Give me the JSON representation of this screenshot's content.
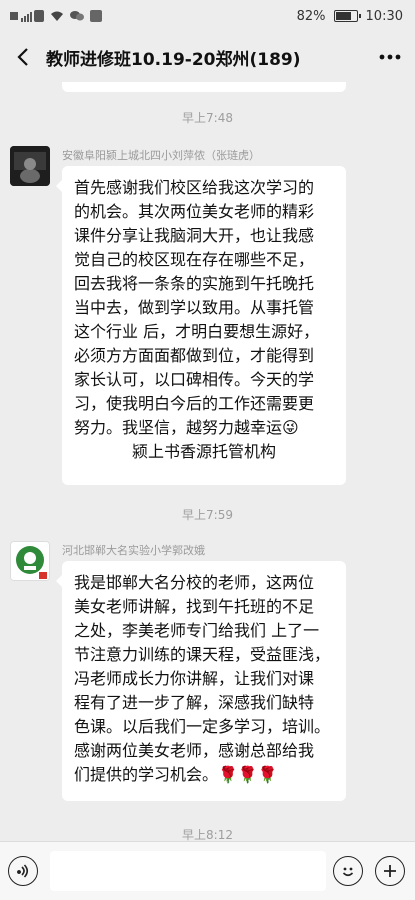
{
  "status": {
    "battery_text": "82%",
    "battery_level": 0.82,
    "time": "10:30"
  },
  "header": {
    "title": "教师进修班10.19-20郑州(189)"
  },
  "messages": [
    {
      "time": "早上7:48",
      "sender": "安徽阜阳颍上城北四小刘萍侬（张琏虎）",
      "lines": [
        "首先感谢我们校区给我这次学习的",
        "的机会。其次两位美女老师的精彩",
        "课件分享让我脑洞大开，也让我感",
        "觉自己的校区现在存在哪些不足，",
        "回去我将一条条的实施到午托晚托",
        "当中去，做到学以致用。从事托管",
        "这个行业 后，才明白要想生源好，",
        "必须方方面面都做到位，才能得到",
        "家长认可，以口碑相传。今天的学",
        "习，使我明白今后的工作还需要更",
        "努力。我坚信，越努力越幸运😜"
      ],
      "signature": "颍上书香源托管机构"
    },
    {
      "time": "早上7:59",
      "sender": "河北邯郸大名实验小学郭改娥",
      "lines": [
        "我是邯郸大名分校的老师，这两位",
        "美女老师讲解，找到午托班的不足",
        "之处，李美老师专门给我们 上了一",
        "节注意力训练的课天程，受益匪浅，",
        "冯老师成长力你讲解，让我们对课",
        "程有了进一步了解，深感我们缺特",
        "色课。以后我们一定多学习，培训。",
        "感谢两位美女老师，感谢总部给我",
        "们提供的学习机会。🌹🌹🌹"
      ]
    }
  ],
  "last_time": "早上8:12",
  "icons": {
    "back": "chevron-left-icon",
    "more": "more-dots-icon",
    "voice": "voice-icon",
    "emoji": "emoji-icon",
    "plus": "plus-icon"
  }
}
